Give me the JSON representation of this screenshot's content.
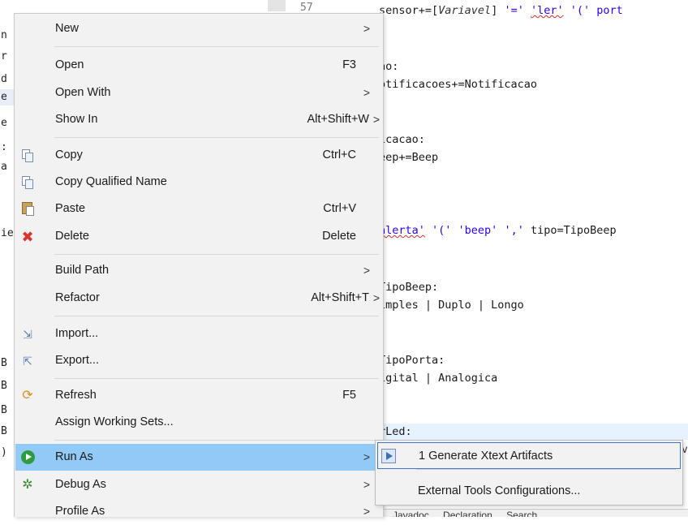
{
  "editor": {
    "line_number": "57",
    "lines": [
      {
        "text_parts": [
          {
            "t": "sensor+=[",
            "c": ""
          },
          {
            "t": "Variavel",
            "c": "it"
          },
          {
            "t": "] ",
            "c": ""
          },
          {
            "t": "'=' ",
            "c": "kw"
          },
          {
            "t": "'ler'",
            "c": "kw sq"
          },
          {
            "t": " '(' port",
            "c": "kw"
          }
        ]
      },
      {
        "text_parts": [
          {
            "t": "ao:",
            "c": ""
          }
        ]
      },
      {
        "text_parts": [
          {
            "t": "otificacoes+=Notificacao",
            "c": ""
          }
        ]
      },
      {
        "text_parts": [
          {
            "t": "icacao:",
            "c": ""
          }
        ]
      },
      {
        "text_parts": [
          {
            "t": "eep+=Beep",
            "c": ""
          }
        ]
      },
      {
        "text_parts": [
          {
            "t": "alerta'",
            "c": "kw sq"
          },
          {
            "t": " '(' 'beep' ',' ",
            "c": "kw"
          },
          {
            "t": "tipo=TipoBeep",
            "c": ""
          }
        ]
      },
      {
        "text_parts": [
          {
            "t": "TipoBeep:",
            "c": ""
          }
        ]
      },
      {
        "text_parts": [
          {
            "t": "imples | Duplo | Longo",
            "c": ""
          }
        ]
      },
      {
        "text_parts": [
          {
            "t": "TipoPorta:",
            "c": ""
          }
        ]
      },
      {
        "text_parts": [
          {
            "t": "igital | Analogica",
            "c": ""
          }
        ]
      },
      {
        "text_parts": [
          {
            "t": "rLed:",
            "c": ""
          }
        ]
      }
    ],
    "tail_char": "v",
    "bottom_tabs": [
      "Javadoc",
      "Declaration",
      "Search"
    ]
  },
  "left_strip": [
    "n",
    "r",
    "d",
    "e",
    "e",
    ":",
    "a",
    "ie",
    "B",
    "B",
    "B",
    "B",
    ")"
  ],
  "menu": {
    "items": [
      {
        "label": "New",
        "accel": "",
        "submenu": true,
        "icon": ""
      },
      {
        "label": "Open",
        "accel": "F3",
        "submenu": false,
        "icon": ""
      },
      {
        "label": "Open With",
        "accel": "",
        "submenu": true,
        "icon": ""
      },
      {
        "label": "Show In",
        "accel": "Alt+Shift+W",
        "submenu": true,
        "icon": ""
      },
      {
        "label": "Copy",
        "accel": "Ctrl+C",
        "submenu": false,
        "icon": "copy-icon"
      },
      {
        "label": "Copy Qualified Name",
        "accel": "",
        "submenu": false,
        "icon": "copy-qualified-icon"
      },
      {
        "label": "Paste",
        "accel": "Ctrl+V",
        "submenu": false,
        "icon": "paste-icon"
      },
      {
        "label": "Delete",
        "accel": "Delete",
        "submenu": false,
        "icon": "delete-icon"
      },
      {
        "label": "Build Path",
        "accel": "",
        "submenu": true,
        "icon": ""
      },
      {
        "label": "Refactor",
        "accel": "Alt+Shift+T",
        "submenu": true,
        "icon": ""
      },
      {
        "label": "Import...",
        "accel": "",
        "submenu": false,
        "icon": "import-icon"
      },
      {
        "label": "Export...",
        "accel": "",
        "submenu": false,
        "icon": "export-icon"
      },
      {
        "label": "Refresh",
        "accel": "F5",
        "submenu": false,
        "icon": "refresh-icon"
      },
      {
        "label": "Assign Working Sets...",
        "accel": "",
        "submenu": false,
        "icon": ""
      },
      {
        "label": "Run As",
        "accel": "",
        "submenu": true,
        "icon": "run-icon",
        "highlighted": true
      },
      {
        "label": "Debug As",
        "accel": "",
        "submenu": true,
        "icon": "debug-icon"
      },
      {
        "label": "Profile As",
        "accel": "",
        "submenu": true,
        "icon": ""
      }
    ],
    "arrow": ">"
  },
  "submenu": {
    "items": [
      {
        "label": "1 Generate Xtext Artifacts",
        "icon": "xtext-run-icon"
      },
      {
        "label": "External Tools Configurations...",
        "icon": ""
      }
    ]
  }
}
